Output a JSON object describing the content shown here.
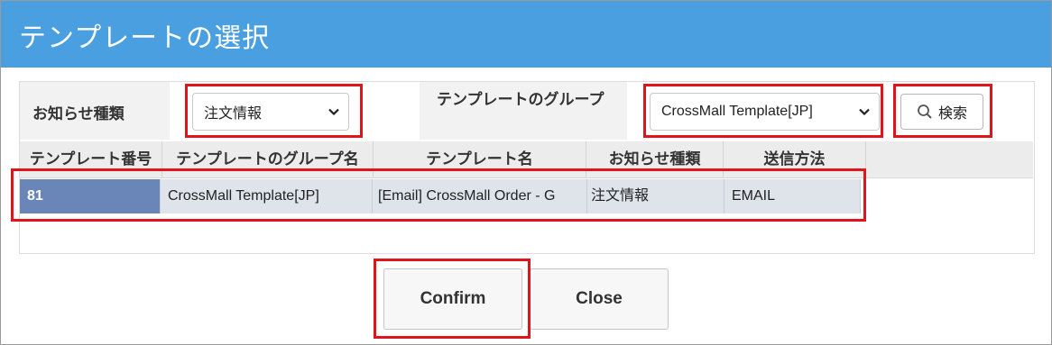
{
  "dialog": {
    "title": "テンプレートの選択"
  },
  "filters": {
    "notice_type_label": "お知らせ種類",
    "notice_type_value": "注文情報",
    "group_label": "テンプレートのグループ",
    "group_value": "CrossMall Template[JP]",
    "search_label": "検索"
  },
  "table": {
    "columns": [
      "テンプレート番号",
      "テンプレートのグループ名",
      "テンプレート名",
      "お知らせ種類",
      "送信方法"
    ],
    "rows": [
      [
        "81",
        "CrossMall Template[JP]",
        "[Email] CrossMall Order - G",
        "注文情報",
        "EMAIL"
      ]
    ]
  },
  "actions": {
    "confirm_label": "Confirm",
    "close_label": "Close"
  },
  "colors": {
    "titlebar": "#4a9fe0",
    "selected_cell": "#6a86b9",
    "highlight": "#e0141a"
  }
}
